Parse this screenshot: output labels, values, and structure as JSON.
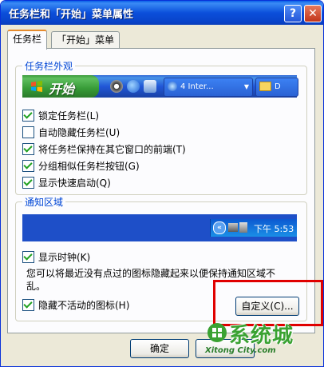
{
  "window": {
    "title": "任务栏和「开始」菜单属性",
    "help_label": "?",
    "close_label": "✕"
  },
  "tabs": [
    {
      "label": "任务栏",
      "active": true
    },
    {
      "label": "「开始」菜单",
      "active": false
    }
  ],
  "taskbar_group": {
    "title": "任务栏外观",
    "preview": {
      "start_label": "开始",
      "task_items": [
        "4 Inter...",
        "D"
      ]
    },
    "options": [
      {
        "label": "锁定任务栏(L)",
        "checked": true
      },
      {
        "label": "自动隐藏任务栏(U)",
        "checked": false
      },
      {
        "label": "将任务栏保持在其它窗口的前端(T)",
        "checked": true
      },
      {
        "label": "分组相似任务栏按钮(G)",
        "checked": true
      },
      {
        "label": "显示快速启动(Q)",
        "checked": true
      }
    ]
  },
  "notify_group": {
    "title": "通知区域",
    "tray_time": "下午 5:53",
    "show_clock": {
      "label": "显示时钟(K)",
      "checked": true
    },
    "description": "您可以将最近没有点过的图标隐藏起来以便保持通知区域不乱。",
    "hide_inactive": {
      "label": "隐藏不活动的图标(H)",
      "checked": true
    },
    "customize_label": "自定义(C)..."
  },
  "footer": {
    "ok_label": "确定"
  },
  "watermark": {
    "text": "系统城",
    "url": "Xitong City.com"
  },
  "colors": {
    "titlebar": "#0b4fdb",
    "highlight_box": "#e00000",
    "group_title": "#0046d5",
    "start_button": "#379b37"
  }
}
